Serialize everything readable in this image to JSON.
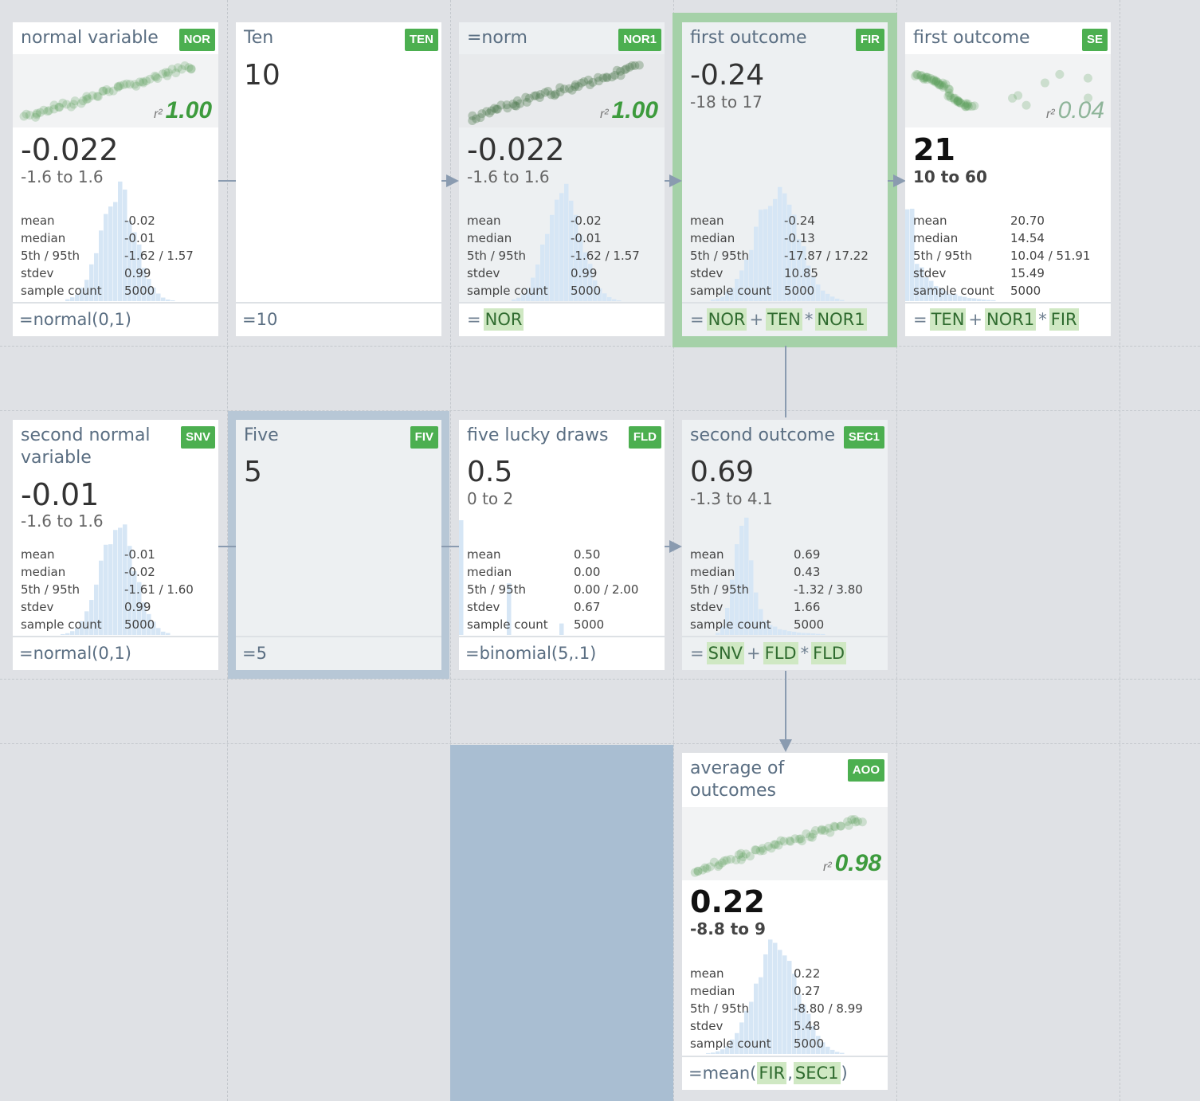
{
  "cells": {
    "nor": {
      "title": "normal variable",
      "badge": "NOR",
      "r2_label": "r²",
      "r2": "1.00",
      "value": "-0.022",
      "range": "-1.6 to 1.6",
      "stats": {
        "mean": "-0.02",
        "median": "-0.01",
        "p5_95": "-1.62 / 1.57",
        "stdev": "0.99",
        "count": "5000"
      },
      "formula": "=normal(0,1)"
    },
    "ten": {
      "title": "Ten",
      "badge": "TEN",
      "value": "10",
      "formula": "=10"
    },
    "nor1": {
      "title": "=norm",
      "badge": "NOR1",
      "r2_label": "r²",
      "r2": "1.00",
      "value": "-0.022",
      "range": "-1.6 to 1.6",
      "stats": {
        "mean": "-0.02",
        "median": "-0.01",
        "p5_95": "-1.62 / 1.57",
        "stdev": "0.99",
        "count": "5000"
      },
      "formula_eq": "=",
      "formula_tokens": [
        "NOR"
      ]
    },
    "fir": {
      "title": "first outcome",
      "badge": "FIR",
      "value": "-0.24",
      "range": "-18 to 17",
      "stats": {
        "mean": "-0.24",
        "median": "-0.13",
        "p5_95": "-17.87 / 17.22",
        "stdev": "10.85",
        "count": "5000"
      },
      "formula_eq": "=",
      "formula_tokens": [
        "NOR",
        "TEN",
        "NOR1"
      ],
      "formula_ops": [
        "+",
        "*"
      ]
    },
    "se": {
      "title": "first outcome",
      "badge": "SE",
      "r2_label": "r²",
      "r2": "0.04",
      "value": "21",
      "range": "10 to 60",
      "stats": {
        "mean": "20.70",
        "median": "14.54",
        "p5_95": "10.04 / 51.91",
        "stdev": "15.49",
        "count": "5000"
      },
      "formula_eq": "=",
      "formula_tokens": [
        "TEN",
        "NOR1",
        "FIR"
      ],
      "formula_ops": [
        "+",
        "*"
      ]
    },
    "snv": {
      "title": "second normal variable",
      "badge": "SNV",
      "value": "-0.01",
      "range": "-1.6 to 1.6",
      "stats": {
        "mean": "-0.01",
        "median": "-0.02",
        "p5_95": "-1.61 / 1.60",
        "stdev": "0.99",
        "count": "5000"
      },
      "formula": "=normal(0,1)"
    },
    "fiv": {
      "title": "Five",
      "badge": "FIV",
      "value": "5",
      "formula": "=5"
    },
    "fld": {
      "title": "five lucky draws",
      "badge": "FLD",
      "value": "0.5",
      "range": "0 to 2",
      "stats": {
        "mean": "0.50",
        "median": "0.00",
        "p5_95": "0.00 / 2.00",
        "stdev": "0.67",
        "count": "5000"
      },
      "formula": "=binomial(5,.1)"
    },
    "sec1": {
      "title": "second outcome",
      "badge": "SEC1",
      "value": "0.69",
      "range": "-1.3 to 4.1",
      "stats": {
        "mean": "0.69",
        "median": "0.43",
        "p5_95": "-1.32 / 3.80",
        "stdev": "1.66",
        "count": "5000"
      },
      "formula_eq": "=",
      "formula_tokens": [
        "SNV",
        "FLD",
        "FLD"
      ],
      "formula_ops": [
        "+",
        "*"
      ]
    },
    "aoo": {
      "title": "average of outcomes",
      "badge": "AOO",
      "r2_label": "r²",
      "r2": "0.98",
      "value": "0.22",
      "range": "-8.8 to 9",
      "stats": {
        "mean": "0.22",
        "median": "0.27",
        "p5_95": "-8.80 / 8.99",
        "stdev": "5.48",
        "count": "5000"
      },
      "formula_prefix": "=mean(",
      "formula_tokens": [
        "FIR",
        "SEC1"
      ],
      "formula_sep": ",",
      "formula_suffix": ")"
    }
  },
  "stat_labels": {
    "mean": "mean",
    "median": "median",
    "p5_95": "5th / 95th",
    "stdev": "stdev",
    "count": "sample count"
  },
  "colors": {
    "badge": "#4caf50",
    "token_bg": "#cfe8c3",
    "histogram": "#d6e6f5",
    "arrow": "#8a9bb0",
    "selection_green": "#a5d1a8",
    "selection_blue": "#b7c7d6"
  }
}
